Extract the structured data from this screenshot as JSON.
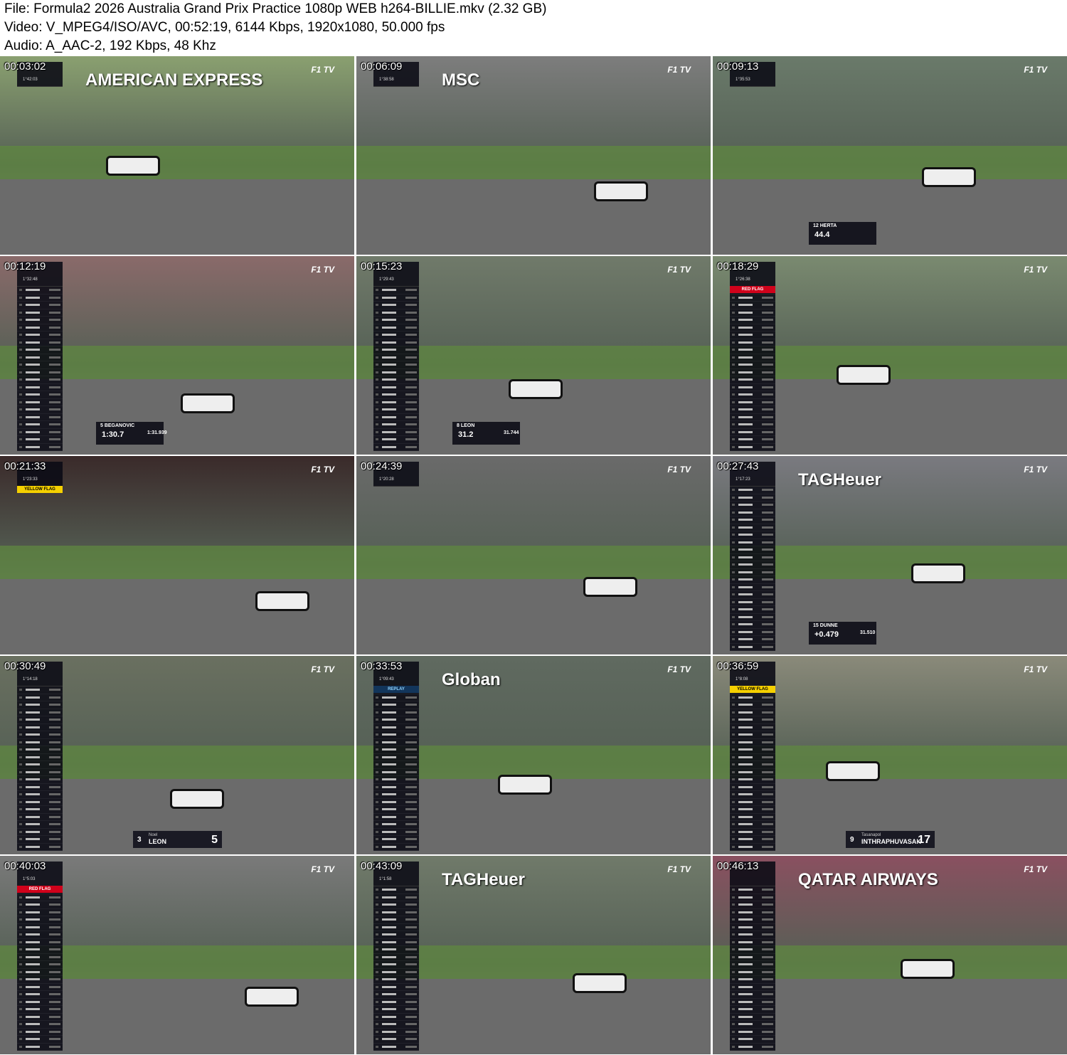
{
  "header": {
    "file_line": "File: Formula2 2026 Australia Grand Prix Practice 1080p WEB h264-BILLIE.mkv (2.32 GB)",
    "video_line": "Video: V_MPEG4/ISO/AVC, 00:52:19, 6144 Kbps, 1920x1080, 50.000 fps",
    "audio_line": "Audio: A_AAC-2, 192 Kbps, 48 Khz"
  },
  "brand_label": "F1 TV",
  "thumbnails": [
    {
      "timestamp": "00:03:02",
      "session_timer": "1°42:03",
      "bg": "#8aa070",
      "banner": "AMERICAN EXPRESS"
    },
    {
      "timestamp": "00:06:09",
      "session_timer": "1°38:58",
      "bg": "#7d7d7d",
      "banner": "MSC"
    },
    {
      "timestamp": "00:09:13",
      "session_timer": "1°35:53",
      "bg": "#6a7a6a",
      "lower": {
        "name": "12 HERTA",
        "value": "44.4"
      }
    },
    {
      "timestamp": "00:12:19",
      "session_timer": "1°32:48",
      "bg": "#8a6a6a",
      "lower": {
        "name": "5 BEGANOVIC",
        "value": "1:30.7",
        "value2": "1:31.939"
      }
    },
    {
      "timestamp": "00:15:23",
      "session_timer": "1°29:43",
      "bg": "#707a6a",
      "lower": {
        "name": "8 LEON",
        "value": "31.2",
        "value2": "31.744"
      }
    },
    {
      "timestamp": "00:18:29",
      "session_timer": "1°26:38",
      "bg": "#7a8a70",
      "flag": {
        "type": "red",
        "text": "RED FLAG"
      }
    },
    {
      "timestamp": "00:21:33",
      "session_timer": "1°23:33",
      "bg": "#3a2a2a",
      "flag": {
        "type": "yellow",
        "text": "YELLOW FLAG"
      }
    },
    {
      "timestamp": "00:24:39",
      "session_timer": "1°20:28",
      "bg": "#6a6a6a"
    },
    {
      "timestamp": "00:27:43",
      "session_timer": "1°17:23",
      "bg": "#7a7a80",
      "banner": "TAGHeuer",
      "lower": {
        "name": "15 DUNNE",
        "value": "+0.479",
        "value2": "31.510"
      }
    },
    {
      "timestamp": "00:30:49",
      "session_timer": "1°14:18",
      "bg": "#6a7060",
      "card": {
        "num": "3",
        "first": "Noel",
        "last": "LEON",
        "big": "5"
      }
    },
    {
      "timestamp": "00:33:53",
      "session_timer": "1°09:43",
      "bg": "#606a60",
      "flag": {
        "type": "replay",
        "text": "REPLAY"
      },
      "banner": "Globan"
    },
    {
      "timestamp": "00:36:59",
      "session_timer": "1°8:08",
      "bg": "#8a8a7a",
      "flag": {
        "type": "yellow",
        "text": "YELLOW FLAG"
      },
      "card": {
        "num": "9",
        "first": "Tasanapol",
        "last": "INTHRAPHUVASAK",
        "big": "17"
      }
    },
    {
      "timestamp": "00:40:03",
      "session_timer": "1°5:03",
      "bg": "#7a7a7a",
      "flag": {
        "type": "red",
        "text": "RED FLAG"
      }
    },
    {
      "timestamp": "00:43:09",
      "session_timer": "1°1:58",
      "bg": "#707a6a",
      "banner": "TAGHeuer"
    },
    {
      "timestamp": "00:46:13",
      "session_timer": "",
      "bg": "#8a5060",
      "banner": "QATAR AIRWAYS"
    }
  ]
}
